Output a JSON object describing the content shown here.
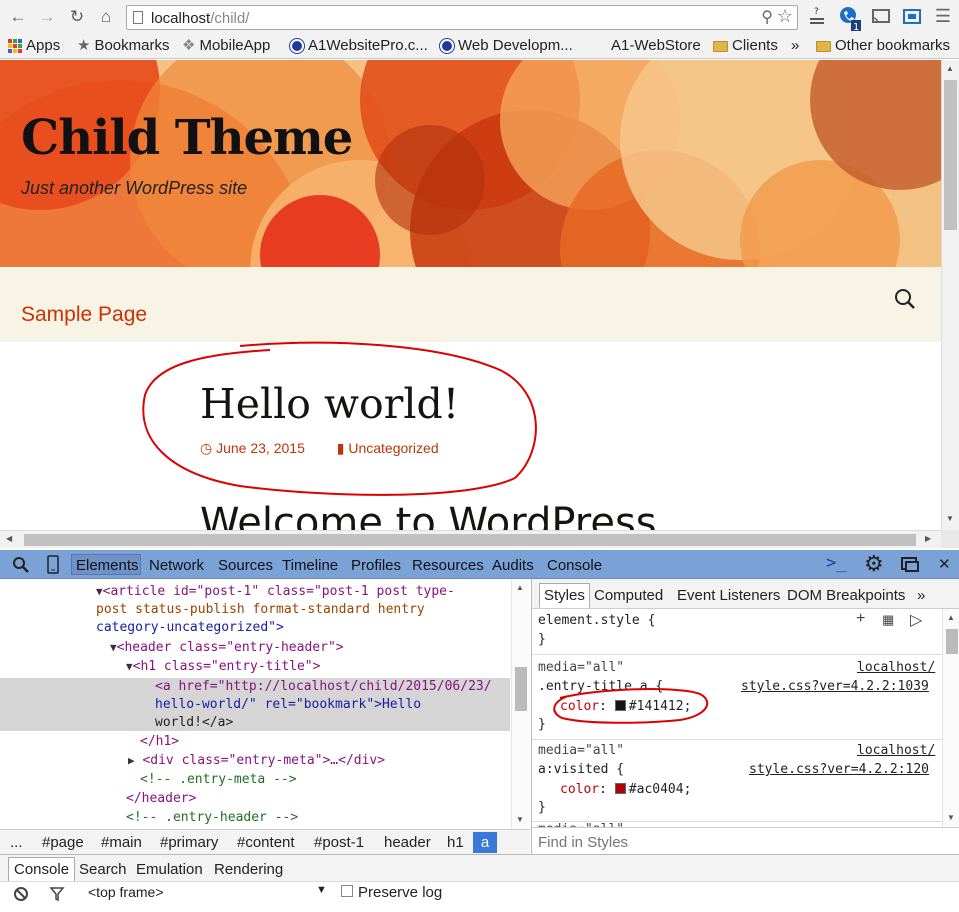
{
  "browser": {
    "url_host": "localhost",
    "url_path": "/child/",
    "bookmarks": [
      {
        "label": "Apps",
        "icon": "apps-icon"
      },
      {
        "label": "Bookmarks",
        "icon": "star-icon"
      },
      {
        "label": "MobileApp",
        "icon": "puzzle-icon"
      },
      {
        "label": "A1WebsitePro.c...",
        "icon": "globe-icon"
      },
      {
        "label": "Web Developm...",
        "icon": "globe-icon"
      },
      {
        "label": "A1-WebStore",
        "icon": "none"
      },
      {
        "label": "Clients",
        "icon": "folder-icon"
      },
      {
        "label": "»",
        "icon": "none"
      },
      {
        "label": "Other bookmarks",
        "icon": "folder-icon"
      }
    ],
    "extension_badge": "1"
  },
  "site": {
    "title": "Child Theme",
    "tagline": "Just another WordPress site",
    "menu_item": "Sample Page",
    "post_title": "Hello world!",
    "post_date": "June 23, 2015",
    "post_category": "Uncategorized",
    "next_heading": "Welcome to WordPress"
  },
  "devtools": {
    "tabs": [
      "Elements",
      "Network",
      "Sources",
      "Timeline",
      "Profiles",
      "Resources",
      "Audits",
      "Console"
    ],
    "breadcrumbs": [
      "...",
      "#page",
      "#main",
      "#primary",
      "#content",
      "#post-1",
      "header",
      "h1",
      "a"
    ],
    "styles_tabs": [
      "Styles",
      "Computed",
      "Event Listeners",
      "DOM Breakpoints",
      "»"
    ],
    "element_style": "element.style {",
    "close_brace": "}",
    "rule1": {
      "media": "media=\"all\"",
      "source_a": "localhost/",
      "source_b": "style.css?ver=4.2.2:1039",
      "selector": ".entry-title a {",
      "prop": "color",
      "value": "#141412",
      "swatch": "#141412"
    },
    "rule2": {
      "media": "media=\"all\"",
      "source_a": "localhost/",
      "source_b": "style.css?ver=4.2.2:120",
      "selector": "a:visited {",
      "prop": "color",
      "value": "#ac0404",
      "swatch": "#ac0404"
    },
    "rule3_partial": "media=\"all\"",
    "find_placeholder": "Find in Styles",
    "drawer_tabs": [
      "Console",
      "Search",
      "Emulation",
      "Rendering"
    ],
    "frame_select": "<top frame>",
    "preserve_log": "Preserve log"
  },
  "dom": {
    "article_open": "<article id=\"post-1\" class=\"post-1 post type-",
    "article_cont1": "post status-publish format-standard hentry",
    "article_cont2": "category-uncategorized\">",
    "header_open": "<header class=\"entry-header\">",
    "h1_open": "<h1 class=\"entry-title\">",
    "a_line1": "<a href=\"http://localhost/child/2015/06/23/",
    "a_line2": "hello-world/\" rel=\"bookmark\">Hello",
    "a_line3": "world!</a>",
    "h1_close": "</h1>",
    "div_meta": "<div class=\"entry-meta\">…</div>",
    "comment_meta": "<!-- .entry-meta -->",
    "header_close": "</header>",
    "comment_header": "<!-- .entry-header -->"
  },
  "colors": {
    "accent_link": "#d22f04",
    "devtools_tabbar": "#7ba2d6",
    "selected_crumb": "#3879d9",
    "annotation": "#dd0000"
  }
}
